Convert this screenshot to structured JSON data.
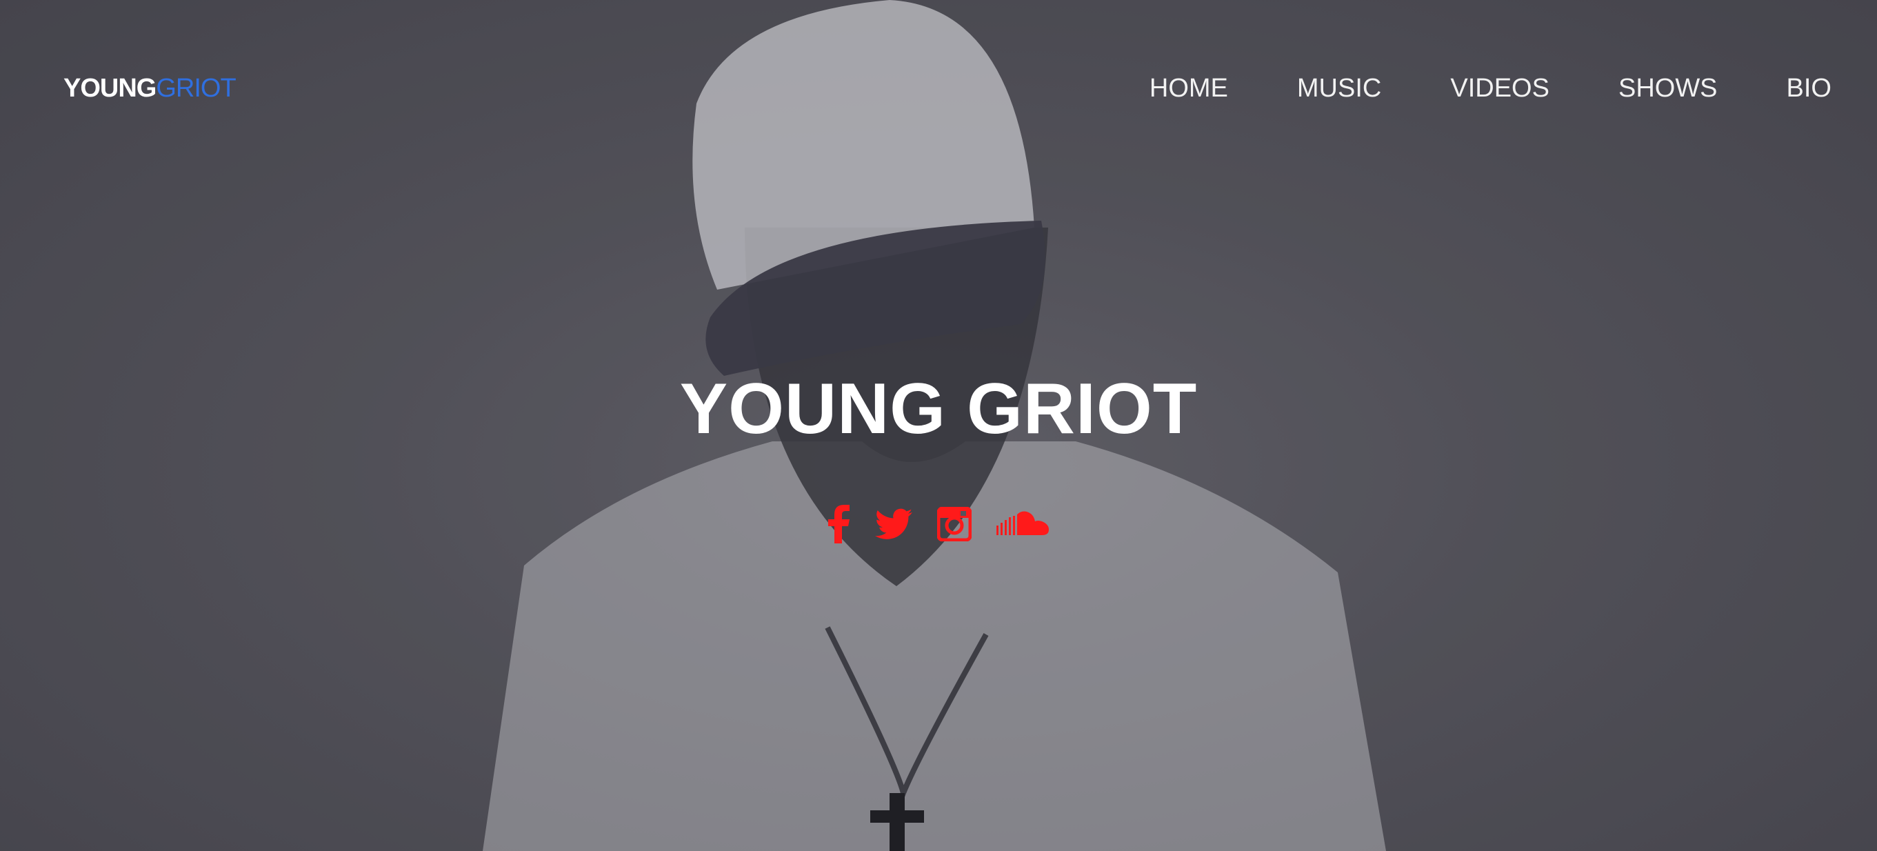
{
  "brand": {
    "logo_part1": "YOUNG",
    "logo_part2": "GRIOT",
    "accent_color": "#2f6fe0"
  },
  "nav": {
    "items": [
      {
        "label": "HOME"
      },
      {
        "label": "MUSIC"
      },
      {
        "label": "VIDEOS"
      },
      {
        "label": "SHOWS"
      },
      {
        "label": "BIO"
      }
    ]
  },
  "hero": {
    "title": "YOUNG GRIOT"
  },
  "socials": {
    "icon_color": "#ff1a1a",
    "items": [
      {
        "icon": "facebook-icon"
      },
      {
        "icon": "twitter-icon"
      },
      {
        "icon": "instagram-icon"
      },
      {
        "icon": "soundcloud-icon"
      }
    ]
  },
  "background": {
    "overlay_color": "#55545c"
  }
}
